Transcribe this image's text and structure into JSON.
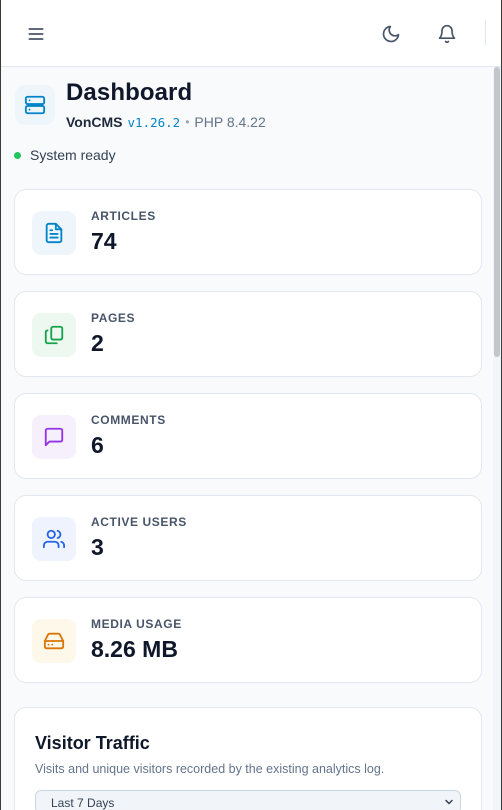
{
  "topbar": {
    "icons": [
      "menu-icon",
      "moon-icon",
      "bell-icon"
    ]
  },
  "header": {
    "title": "Dashboard",
    "app_name": "VonCMS",
    "version": "v1.26.2",
    "separator": "•",
    "php": "PHP 8.4.22",
    "icon": "server-icon"
  },
  "status": {
    "text": "System ready",
    "color": "#22c55e"
  },
  "stats": [
    {
      "label": "ARTICLES",
      "value": "74",
      "icon": "document-icon",
      "color": "#0284c7",
      "bg": "#eef6fc"
    },
    {
      "label": "PAGES",
      "value": "2",
      "icon": "copy-icon",
      "color": "#16a34a",
      "bg": "#edf8f1"
    },
    {
      "label": "COMMENTS",
      "value": "6",
      "icon": "message-icon",
      "color": "#9333ea",
      "bg": "#f6f0fd"
    },
    {
      "label": "ACTIVE USERS",
      "value": "3",
      "icon": "users-icon",
      "color": "#2563eb",
      "bg": "#eef3fd"
    },
    {
      "label": "MEDIA USAGE",
      "value": "8.26 MB",
      "icon": "hard-drive-icon",
      "color": "#d97706",
      "bg": "#fef8eb"
    }
  ],
  "traffic": {
    "title": "Visitor Traffic",
    "description": "Visits and unique visitors recorded by the existing analytics log.",
    "range_selected": "Last 7 Days"
  }
}
